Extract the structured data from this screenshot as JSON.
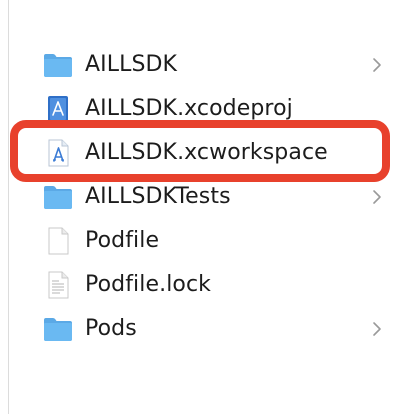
{
  "files": [
    {
      "name": "AILLSDK",
      "type": "folder",
      "icon": "folder-icon",
      "expandable": true
    },
    {
      "name": "AILLSDK.xcodeproj",
      "type": "xcodeproj",
      "icon": "xcodeproj-icon",
      "expandable": false
    },
    {
      "name": "AILLSDK.xcworkspace",
      "type": "xcworkspace",
      "icon": "xcworkspace-icon",
      "expandable": false,
      "highlighted": true
    },
    {
      "name": "AILLSDKTests",
      "type": "folder",
      "icon": "folder-icon",
      "expandable": true
    },
    {
      "name": "Podfile",
      "type": "file",
      "icon": "blank-document-icon",
      "expandable": false
    },
    {
      "name": "Podfile.lock",
      "type": "file",
      "icon": "text-document-icon",
      "expandable": false
    },
    {
      "name": "Pods",
      "type": "folder",
      "icon": "folder-icon",
      "expandable": true
    }
  ],
  "colors": {
    "highlight_border": "#e8412c",
    "folder_blue": "#5fb1ef",
    "text": "#1c1c1c"
  }
}
